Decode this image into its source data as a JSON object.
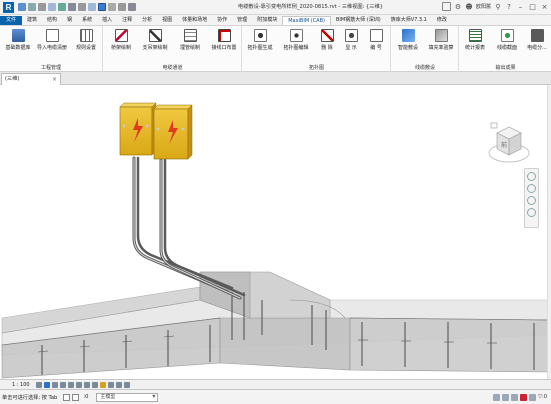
{
  "app": {
    "logo": "R",
    "title": "电缆敷设-靠引变电所样例_2020-0815.rvt - 三维视图: {三维}",
    "user": "欧阳嚚",
    "help": "?",
    "accent": "#0a64ad"
  },
  "tabs": [
    {
      "label": "文件"
    },
    {
      "label": "建筑"
    },
    {
      "label": "结构"
    },
    {
      "label": "钢"
    },
    {
      "label": "系统"
    },
    {
      "label": "插入"
    },
    {
      "label": "注释"
    },
    {
      "label": "分析"
    },
    {
      "label": "视图"
    },
    {
      "label": "体量和场地"
    },
    {
      "label": "协作"
    },
    {
      "label": "管理"
    },
    {
      "label": "附加模块"
    },
    {
      "label": "MaxiBIM (CAB)"
    },
    {
      "label": "BIM钢筋大师 (深圳)"
    },
    {
      "label": "族库大师V7.3.1"
    },
    {
      "label": "修改"
    }
  ],
  "ribbon": {
    "panels": [
      {
        "title": "工程管理",
        "buttons": [
          {
            "label": "基础数据库",
            "icon": "database-icon"
          },
          {
            "label": "导入电缆清册",
            "icon": "import-icon"
          },
          {
            "label": "规则设置",
            "icon": "rules-icon"
          }
        ]
      },
      {
        "title": "电缆通道",
        "buttons": [
          {
            "label": "桥架绘制",
            "icon": "tray-icon"
          },
          {
            "label": "支吊架绘制",
            "icon": "hanger-icon"
          },
          {
            "label": "埋管绘制",
            "icon": "conduit-icon"
          },
          {
            "label": "接线口布置",
            "icon": "port-icon"
          }
        ]
      },
      {
        "title": "拓扑图",
        "buttons": [
          {
            "label": "拓扑图生成",
            "icon": "topology-icon"
          },
          {
            "label": "拓扑图编辑",
            "icon": "topology-edit-icon"
          },
          {
            "label": "删 除",
            "icon": "delete-icon"
          },
          {
            "label": "显 示",
            "icon": "show-icon"
          },
          {
            "label": "编 号",
            "icon": "number-icon"
          }
        ]
      },
      {
        "title": "线缆敷设",
        "buttons": [
          {
            "label": "智能敷设",
            "icon": "smart-lay-icon"
          },
          {
            "label": "填充率验算",
            "icon": "fill-check-icon"
          }
        ]
      },
      {
        "title": "输出成果",
        "buttons": [
          {
            "label": "统计报表",
            "icon": "report-icon"
          },
          {
            "label": "线缆截面",
            "icon": "cable-section-icon"
          },
          {
            "label": "电缆分...",
            "icon": "cable-split-icon"
          }
        ]
      }
    ]
  },
  "view": {
    "tab_label": "(三维)",
    "close": "×",
    "viewcube_label": "前",
    "navbar_items": [
      "wheel-icon",
      "zoom-icon",
      "pan-icon",
      "orbit-icon"
    ]
  },
  "viewcontrol": {
    "scale": "1 : 100"
  },
  "status": {
    "text": "单击可进行选择; 按 Tab",
    "zero": ":0",
    "model": "主模型",
    "filter": "▽:0"
  }
}
